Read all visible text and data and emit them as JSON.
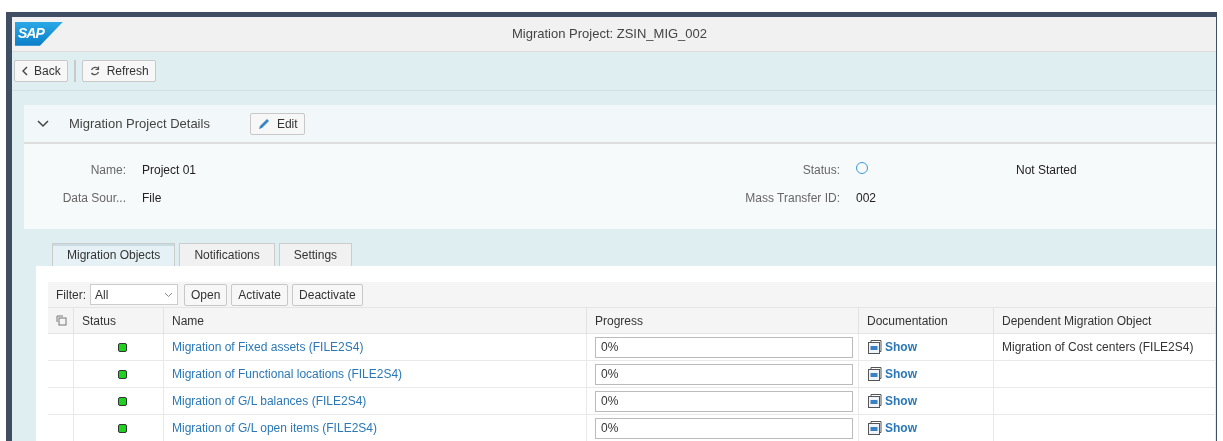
{
  "window": {
    "logo": "SAP",
    "title": "Migration Project: ZSIN_MIG_002"
  },
  "toolbar": [
    {
      "label": "Back",
      "kind": "back"
    },
    {
      "label": "Refresh",
      "kind": "refresh"
    }
  ],
  "section": {
    "title": "Migration Project Details",
    "expanded": true,
    "edit_button": "Edit",
    "fields_left": [
      {
        "label": "Name:",
        "value": "Project 01"
      },
      {
        "label": "Data Sour...",
        "value": "File"
      }
    ],
    "status": {
      "label": "Status:",
      "value": "Not Started"
    },
    "mass_transfer": {
      "label": "Mass Transfer ID:",
      "value": "002"
    }
  },
  "tabs": [
    {
      "label": "Migration Objects",
      "selected": true
    },
    {
      "label": "Notifications",
      "selected": false
    },
    {
      "label": "Settings",
      "selected": false
    }
  ],
  "filter": {
    "label": "Filter:",
    "value": "All"
  },
  "actions": [
    "Open",
    "Activate",
    "Deactivate"
  ],
  "table": {
    "columns": [
      "Status",
      "Name",
      "Progress",
      "Documentation",
      "Dependent Migration Object"
    ],
    "rows": [
      {
        "color": "#1fd21f",
        "name": "Migration of Fixed assets (FILE2S4)",
        "progress": "0%",
        "documentation": "Show",
        "dependent": "Migration of Cost centers (FILE2S4)"
      },
      {
        "color": "#1fd21f",
        "name": "Migration of Functional locations (FILE2S4)",
        "progress": "0%",
        "documentation": "Show"
      },
      {
        "color": "#1fd21f",
        "name": "Migration of G/L balances (FILE2S4)",
        "progress": "0%",
        "documentation": "Show"
      },
      {
        "color": "#1fd21f",
        "name": "Migration of G/L open items (FILE2S4)",
        "progress": "0%",
        "documentation": "Show"
      }
    ]
  }
}
